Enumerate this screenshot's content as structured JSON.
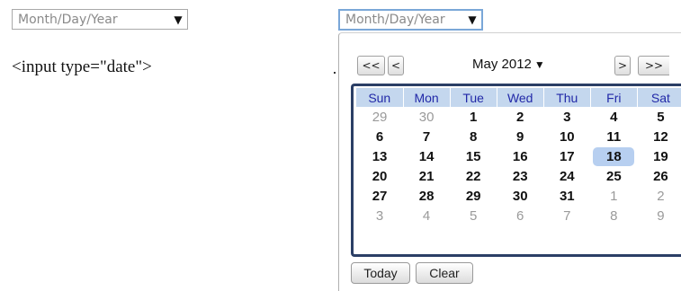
{
  "left_input": {
    "placeholder": "Month/Day/Year",
    "arrow": "▼"
  },
  "caption": "<input type=\"date\">",
  "right_input": {
    "placeholder": "Month/Day/Year",
    "arrow": "▼"
  },
  "picker": {
    "nav": {
      "prev_year": "<<",
      "prev_month": "<",
      "next_month": ">",
      "next_year": ">>"
    },
    "month_label": "May 2012",
    "month_caret": "▼",
    "weekdays": [
      "Sun",
      "Mon",
      "Tue",
      "Wed",
      "Thu",
      "Fri",
      "Sat"
    ],
    "weeks": [
      [
        {
          "d": "29",
          "other": true
        },
        {
          "d": "30",
          "other": true
        },
        {
          "d": "1"
        },
        {
          "d": "2"
        },
        {
          "d": "3"
        },
        {
          "d": "4"
        },
        {
          "d": "5"
        }
      ],
      [
        {
          "d": "6"
        },
        {
          "d": "7"
        },
        {
          "d": "8"
        },
        {
          "d": "9"
        },
        {
          "d": "10"
        },
        {
          "d": "11"
        },
        {
          "d": "12"
        }
      ],
      [
        {
          "d": "13"
        },
        {
          "d": "14"
        },
        {
          "d": "15"
        },
        {
          "d": "16"
        },
        {
          "d": "17"
        },
        {
          "d": "18",
          "selected": true
        },
        {
          "d": "19"
        }
      ],
      [
        {
          "d": "20"
        },
        {
          "d": "21"
        },
        {
          "d": "22"
        },
        {
          "d": "23"
        },
        {
          "d": "24"
        },
        {
          "d": "25"
        },
        {
          "d": "26"
        }
      ],
      [
        {
          "d": "27"
        },
        {
          "d": "28"
        },
        {
          "d": "29"
        },
        {
          "d": "30"
        },
        {
          "d": "31"
        },
        {
          "d": "1",
          "other": true
        },
        {
          "d": "2",
          "other": true
        }
      ],
      [
        {
          "d": "3",
          "other": true
        },
        {
          "d": "4",
          "other": true
        },
        {
          "d": "5",
          "other": true
        },
        {
          "d": "6",
          "other": true
        },
        {
          "d": "7",
          "other": true
        },
        {
          "d": "8",
          "other": true
        },
        {
          "d": "9",
          "other": true
        }
      ]
    ],
    "today_label": "Today",
    "clear_label": "Clear"
  },
  "colors": {
    "header_bg": "#c4d7ee",
    "header_text": "#2229a8",
    "selected_bg": "#b7cff0",
    "grid_border": "#2b3f66",
    "focus_border": "#7aa7d8"
  }
}
